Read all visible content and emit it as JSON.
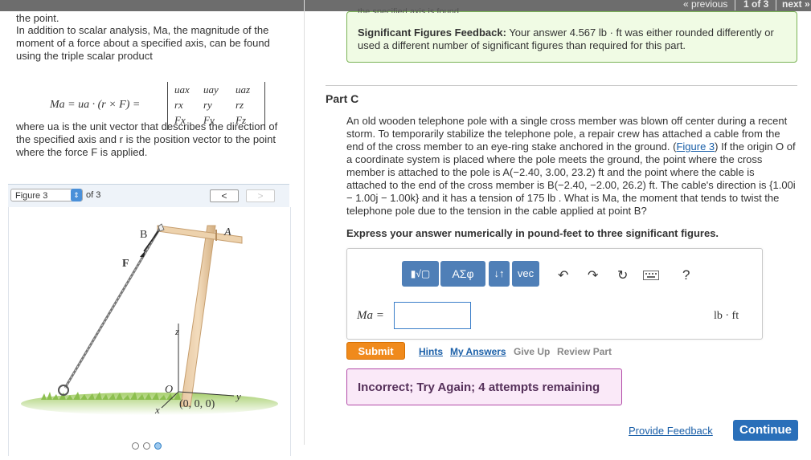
{
  "top_nav": {
    "previous": "« previous",
    "page_status": "1 of 3",
    "next": "next »"
  },
  "left": {
    "intro_fragment": "the point.",
    "paragraph1": "In addition to scalar analysis, Ma, the magnitude of the moment of a force about a specified axis, can be found using the triple scalar product",
    "formula_lhs": "Ma = ua · (r × F) =",
    "matrix": [
      "uax",
      "uay",
      "uaz",
      "rx",
      "ry",
      "rz",
      "Fx",
      "Fy",
      "Fz"
    ],
    "paragraph2": "where ua is the unit vector that describes the direction of the specified axis and r is the position vector to the point where the force F is applied.",
    "figure_select": "Figure 3",
    "figure_of": "of 3",
    "prev_button": "<",
    "next_button": ">",
    "figure_labels": {
      "a": "A",
      "b": "B",
      "f": "F",
      "z": "z",
      "o": "O",
      "x": "x",
      "y": "y",
      "origin": "(0, 0, 0)"
    }
  },
  "right": {
    "feedback_fragment": "the specified axis is found.",
    "feedback_label": "Significant Figures Feedback:",
    "feedback_text": "Your answer 4.567 lb · ft was either rounded differently or used a different number of significant figures than required for this part.",
    "part_title": "Part C",
    "problem_a": "An old wooden telephone pole with a single cross member was blown off center during a recent storm. To temporarily stabilize the telephone pole, a repair crew has attached a cable from the end of the cross member to an eye-ring stake anchored in the ground. (",
    "figure_link": "Figure 3",
    "problem_b": ") If the origin O of a coordinate system is placed where the pole meets the ground, the point where the cross member is attached to the pole is A(−2.40, 3.00, 23.2) ft and the point where the cable is attached to the end of the cross member is B(−2.40, −2.00, 26.2) ft. The cable's direction is {1.00i − 1.00j − 1.00k} and it has a tension of 175 lb . What is Ma, the moment that tends to twist the telephone pole due to the tension in the cable applied at point B?",
    "instruction": "Express your answer numerically in pound-feet to three significant figures.",
    "toolbar": {
      "template_button": "▮√▢",
      "greek_button": "ΑΣφ",
      "sort_button": "↓↑",
      "vec_button": "vec",
      "undo_icon": "undo-icon",
      "redo_icon": "redo-icon",
      "reset_icon": "reset-icon",
      "keyboard_icon": "keyboard-icon",
      "help": "?"
    },
    "answer_label": "Ma =",
    "answer_value": "",
    "unit": "lb · ft",
    "submit": "Submit",
    "hints": "Hints",
    "my_answers": "My Answers",
    "give_up": "Give Up",
    "review_part": "Review Part",
    "status": "Incorrect; Try Again; 4 attempts remaining",
    "provide_feedback": "Provide Feedback",
    "continue": "Continue"
  }
}
